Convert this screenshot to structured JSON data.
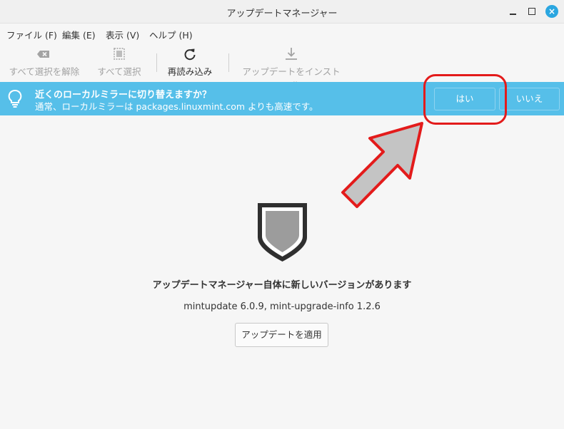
{
  "window": {
    "title": "アップデートマネージャー",
    "close_glyph": "×"
  },
  "menubar": {
    "items": [
      {
        "label": "ファイル (F)"
      },
      {
        "label": "編集 (E)"
      },
      {
        "label": "表示 (V)"
      },
      {
        "label": "ヘルプ (H)"
      }
    ]
  },
  "toolbar": {
    "clear_selection": {
      "label": "すべて選択を解除",
      "icon": "clear-selection-icon",
      "enabled": false
    },
    "select_all": {
      "label": "すべて選択",
      "icon": "select-all-icon",
      "enabled": false
    },
    "refresh": {
      "label": "再読み込み",
      "icon": "refresh-icon",
      "enabled": true
    },
    "install": {
      "label": "アップデートをインストール",
      "icon": "download-icon",
      "enabled": false
    }
  },
  "infobar": {
    "title": "近くのローカルミラーに切り替えますか？",
    "subtitle": "通常、ローカルミラーは packages.linuxmint.com よりも高速です。",
    "yes_label": "はい",
    "no_label": "いいえ",
    "background": "#56bfe9",
    "icon": "lightbulb-icon"
  },
  "annotation": {
    "highlight_color": "#e31b1b",
    "arrow_fill": "#c4c4c4"
  },
  "main": {
    "icon": "shield-icon",
    "title": "アップデートマネージャー自体に新しいバージョンがあります",
    "version": "mintupdate 6.0.9, mint-upgrade-info 1.2.6",
    "apply_label": "アップデートを適用"
  }
}
